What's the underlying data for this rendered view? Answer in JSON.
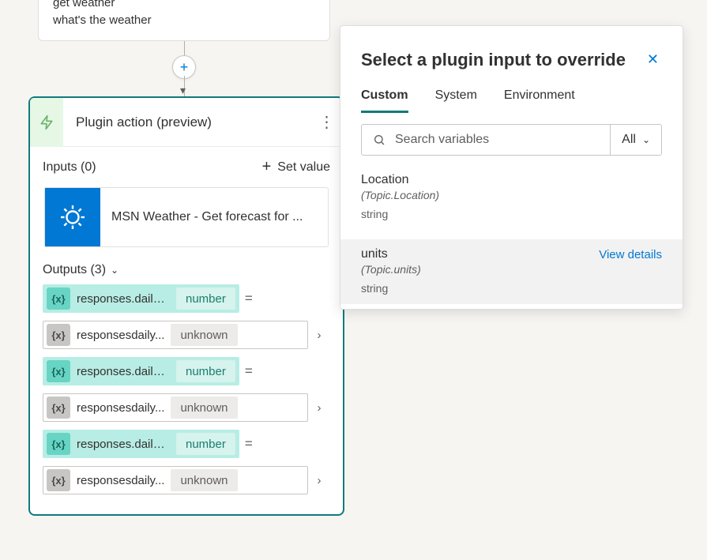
{
  "trigger": {
    "line1": "get weather",
    "line2": "what's the weather"
  },
  "action": {
    "title": "Plugin action (preview)",
    "inputs_label": "Inputs (0)",
    "set_value_label": "Set value",
    "connector_name": "MSN Weather - Get forecast for ...",
    "outputs_label": "Outputs (3)",
    "outputs": [
      {
        "style": "teal",
        "name": "responses.daily....",
        "type": "number",
        "tail": "eq"
      },
      {
        "style": "gray",
        "name": "responsesdaily...",
        "type": "unknown",
        "tail": "arrow"
      },
      {
        "style": "teal",
        "name": "responses.daily....",
        "type": "number",
        "tail": "eq"
      },
      {
        "style": "gray",
        "name": "responsesdaily...",
        "type": "unknown",
        "tail": "arrow"
      },
      {
        "style": "teal",
        "name": "responses.daily....",
        "type": "number",
        "tail": "eq"
      },
      {
        "style": "gray",
        "name": "responsesdaily...",
        "type": "unknown",
        "tail": "arrow"
      }
    ]
  },
  "panel": {
    "title": "Select a plugin input to override",
    "tabs": {
      "custom": "Custom",
      "system": "System",
      "environment": "Environment"
    },
    "search_placeholder": "Search variables",
    "filter_label": "All",
    "view_details": "View details",
    "vars": [
      {
        "name": "Location",
        "path": "(Topic.Location)",
        "type": "string",
        "hover": false
      },
      {
        "name": "units",
        "path": "(Topic.units)",
        "type": "string",
        "hover": true
      }
    ]
  }
}
